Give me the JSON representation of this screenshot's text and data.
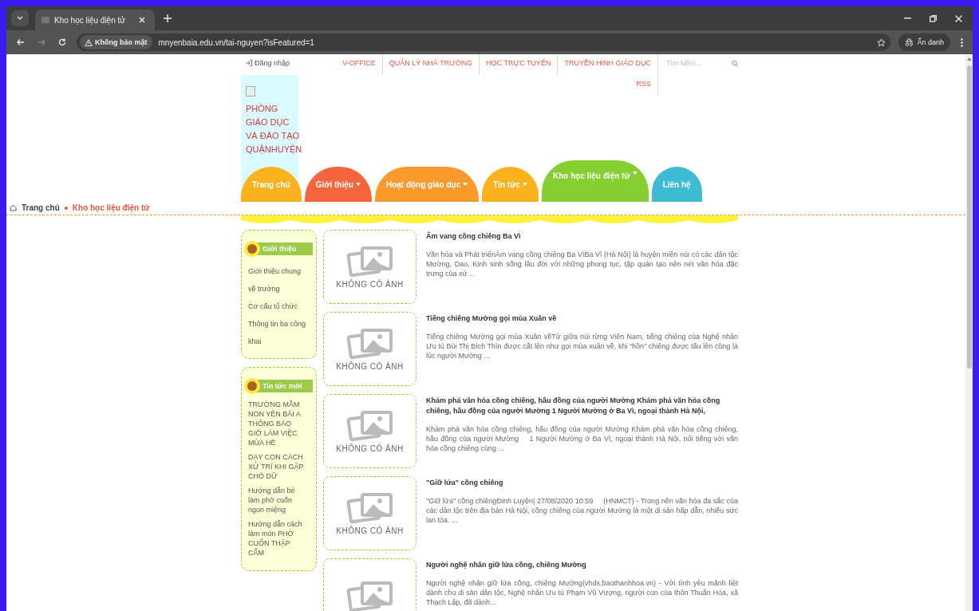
{
  "browser": {
    "tab_title": "Kho học liệu điện tử",
    "security_label": "Không bảo mật",
    "url": "mnyenbaia.edu.vn/tai-nguyen?isFeatured=1",
    "profile_label": "Ẩn danh"
  },
  "top_bar": {
    "login": "Đăng nhập",
    "links": [
      "V-OFFICE",
      "QUẢN LÝ NHÀ TRƯỜNG",
      "HỌC TRỰC TUYẾN",
      "TRUYỀN HÌNH GIÁO DỤC",
      "RSS"
    ],
    "search": {
      "placeholder": "Tìm kiếm..."
    }
  },
  "logo_lines": [
    "PHÒNG",
    "GIÁO DỤC",
    "VÀ ĐÀO TẠO",
    "QUẬNHUYỆN"
  ],
  "nav": [
    {
      "label": "Trang chủ",
      "color": "#fbb21e",
      "dropdown": false,
      "selected": false
    },
    {
      "label": "Giới thiệu",
      "color": "#f7653f",
      "dropdown": true,
      "selected": false
    },
    {
      "label": "Hoạt động giáo dục",
      "color": "#fb9a2c",
      "dropdown": true,
      "selected": false
    },
    {
      "label": "Tin tức",
      "color": "#fbb21e",
      "dropdown": true,
      "selected": false
    },
    {
      "label": "Kho học liệu điện tử",
      "color": "#86cf30",
      "dropdown": true,
      "selected": true
    },
    {
      "label": "Liên hệ",
      "color": "#3dbcd4",
      "dropdown": false,
      "selected": false
    }
  ],
  "breadcrumb": [
    "Trang chủ",
    "Kho học liệu điện tử"
  ],
  "sidebar": [
    {
      "title": "Giới thiệu",
      "kind": "intro",
      "items": [
        "Giới thiệu chung về trường",
        "Cơ cấu tổ chức",
        "Thông tin ba công khai"
      ]
    },
    {
      "title": "Tin tức mới",
      "kind": "news",
      "items": [
        "TRƯỜNG MẦM NON YÊN BÁI A THÔNG BÁO GIỜ LÀM VIỆC MÙA HÈ",
        "DẠY CON CÁCH XỬ TRÍ KHI GẶP CHÓ DỮ",
        "Hướng dẫn bé làm phở cuốn ngon miệng",
        "Hướng dẫn cách làm món PHỞ CUỐN THẬP CẨM"
      ]
    }
  ],
  "articles": [
    {
      "no_image_label": "KHÔNG CÓ ẢNH",
      "title": "Âm vang cồng chiêng Ba Vì",
      "summary": "Văn hóa và Phát triểnÂm vang cồng chiêng Ba VìBa Vì (Hà Nội) là huyện miền núi có các dân tộc Mường, Dao, Kinh sinh sống lâu đời với những phong tục, tập quán tạo nên nét văn hóa đặc trưng của xứ ..."
    },
    {
      "no_image_label": "KHÔNG CÓ ẢNH",
      "title": "Tiếng chiêng Mường gọi mùa Xuân về",
      "summary": "Tiếng chiêng Mường gọi mùa Xuân vềTừ giữa núi rừng Viên Nam, tiếng chiêng của Nghệ nhân Ưu tú Bùi Thị Bích Thìn được cất lên như gọi mùa xuân về, khi “hồn” chiêng được tấu lên cũng là lúc người Mường ..."
    },
    {
      "no_image_label": "KHÔNG CÓ ẢNH",
      "title": "Khám phá văn hóa cồng chiêng, hầu đồng của người Mường Khám phá văn hóa cồng chiêng, hầu đồng của người Mường 1 Người Mường ở Ba Vì, ngoại thành Hà Nội,",
      "summary": "Khám phá văn hóa cồng chiêng, hầu đồng của người Mường Khám phá văn hóa cồng chiêng, hầu đồng của người Mường    1 Người Mường ở Ba Vì, ngoại thành Hà Nội, nổi tiếng với văn hóa cồng chiêng cùng ..."
    },
    {
      "no_image_label": "KHÔNG CÓ ẢNH",
      "title": "\"Giữ lửa\" cồng chiêng",
      "summary": "\"Giữ lửa\" cồng chiêngĐinh Luyện| 27/08/2020 10:59     (HNMCT) - Trong nền văn hóa đa sắc của các dân tộc trên địa bàn Hà Nội, cồng chiêng của người Mường là một di sản hấp dẫn, nhiều sức lan tỏa. ..."
    },
    {
      "title": "Người nghệ nhân giữ lửa cồng, chiêng Mường",
      "summary": "Người nghệ nhân giữ lửa cồng, chiêng Mường(vhds.baothanhhoa.vn) - Với tình yêu mãnh liệt dành cho di sản dân tộc, Nghệ nhân Ưu tú Phạm Vũ Vượng, người con của thôn Thuần Hóa, xã Thạch Lập, đã dành..."
    }
  ]
}
